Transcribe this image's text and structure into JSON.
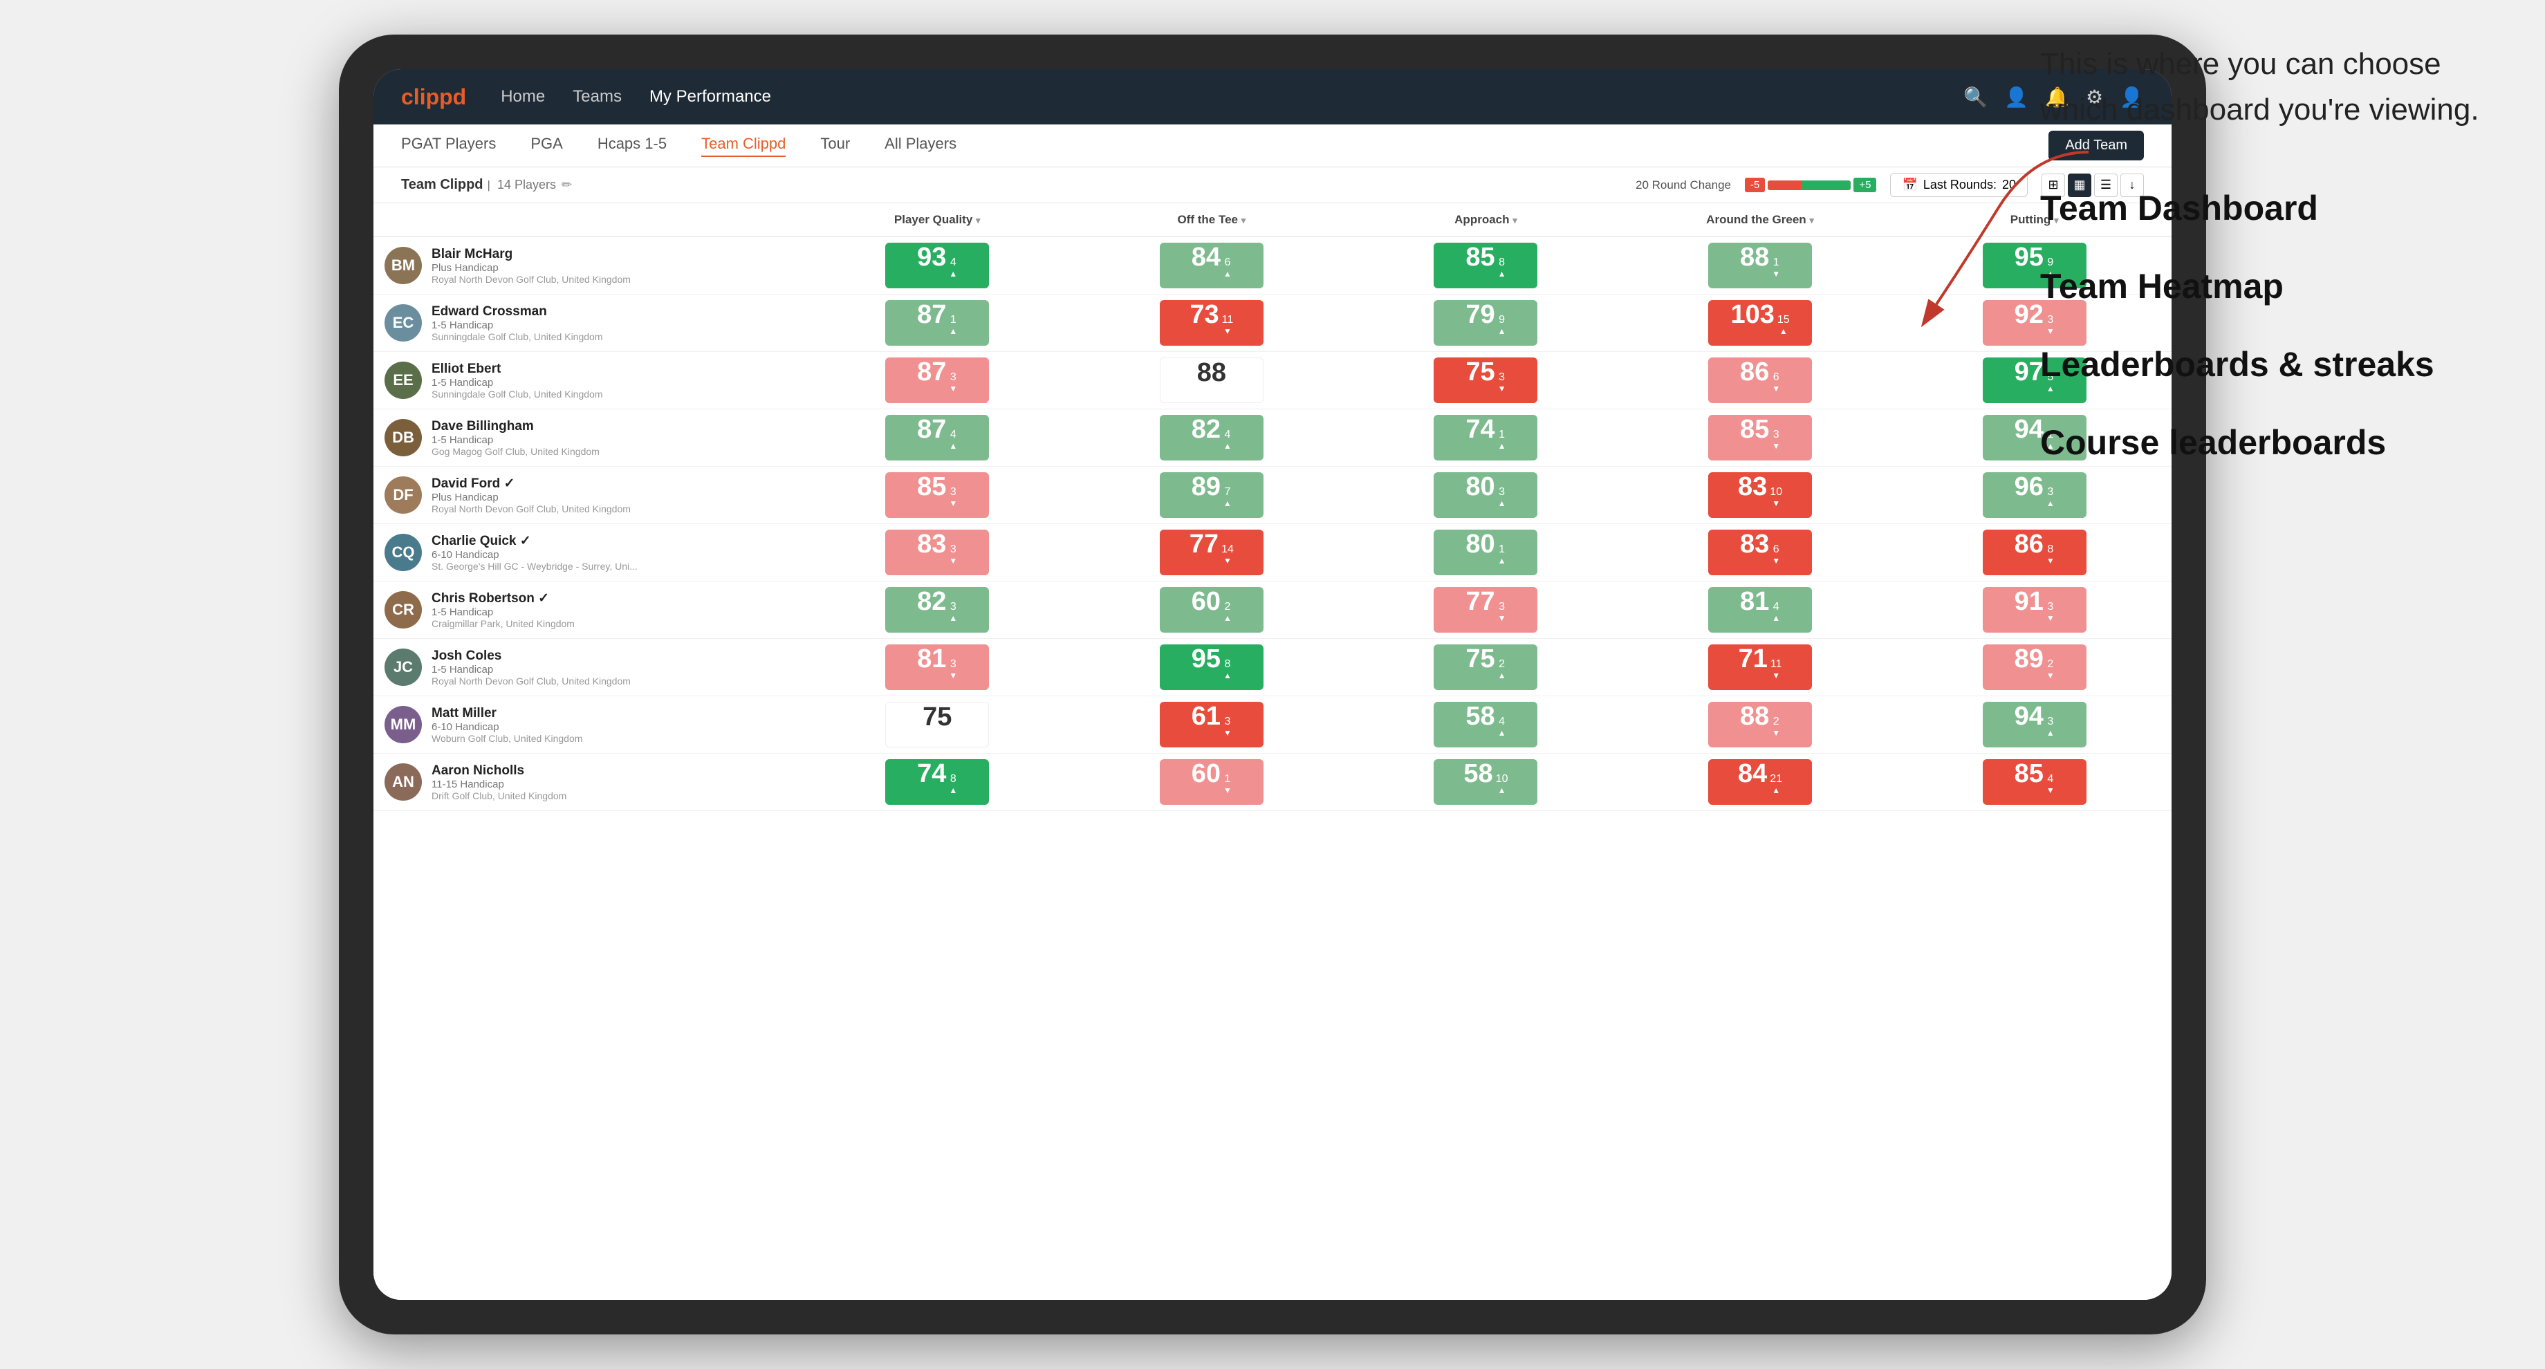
{
  "annotation": {
    "tooltip": "This is where you can choose which dashboard you're viewing.",
    "menu_items": [
      "Team Dashboard",
      "Team Heatmap",
      "Leaderboards & streaks",
      "Course leaderboards"
    ]
  },
  "nav": {
    "logo": "clippd",
    "links": [
      "Home",
      "Teams",
      "My Performance"
    ],
    "active_link": "My Performance"
  },
  "sub_nav": {
    "links": [
      "PGAT Players",
      "PGA",
      "Hcaps 1-5",
      "Team Clippd",
      "Tour",
      "All Players"
    ],
    "active_link": "Team Clippd",
    "add_team_label": "Add Team"
  },
  "team_bar": {
    "team_name": "Team Clippd",
    "player_count": "14 Players",
    "round_change_label": "20 Round Change",
    "change_neg": "-5",
    "change_pos": "+5",
    "last_rounds_label": "Last Rounds:",
    "last_rounds_value": "20"
  },
  "table": {
    "headers": [
      {
        "label": "Player Quality",
        "key": "player_quality",
        "sortable": true
      },
      {
        "label": "Off the Tee",
        "key": "off_tee",
        "sortable": true
      },
      {
        "label": "Approach",
        "key": "approach",
        "sortable": true
      },
      {
        "label": "Around the Green",
        "key": "around_green",
        "sortable": true
      },
      {
        "label": "Putting",
        "key": "putting",
        "sortable": true
      }
    ],
    "players": [
      {
        "name": "Blair McHarg",
        "hcp": "Plus Handicap",
        "club": "Royal North Devon Golf Club, United Kingdom",
        "avatar_color": "#8B7355",
        "initials": "BM",
        "scores": {
          "player_quality": {
            "value": 93,
            "delta": 4,
            "dir": "up",
            "color": "green-dark"
          },
          "off_tee": {
            "value": 84,
            "delta": 6,
            "dir": "up",
            "color": "green-light"
          },
          "approach": {
            "value": 85,
            "delta": 8,
            "dir": "up",
            "color": "green-dark"
          },
          "around_green": {
            "value": 88,
            "delta": 1,
            "dir": "down",
            "color": "green-light"
          },
          "putting": {
            "value": 95,
            "delta": 9,
            "dir": "up",
            "color": "green-dark"
          }
        }
      },
      {
        "name": "Edward Crossman",
        "hcp": "1-5 Handicap",
        "club": "Sunningdale Golf Club, United Kingdom",
        "avatar_color": "#6B8E9F",
        "initials": "EC",
        "scores": {
          "player_quality": {
            "value": 87,
            "delta": 1,
            "dir": "up",
            "color": "green-light"
          },
          "off_tee": {
            "value": 73,
            "delta": 11,
            "dir": "down",
            "color": "red-dark"
          },
          "approach": {
            "value": 79,
            "delta": 9,
            "dir": "up",
            "color": "green-light"
          },
          "around_green": {
            "value": 103,
            "delta": 15,
            "dir": "up",
            "color": "red-dark"
          },
          "putting": {
            "value": 92,
            "delta": 3,
            "dir": "down",
            "color": "red-light"
          }
        }
      },
      {
        "name": "Elliot Ebert",
        "hcp": "1-5 Handicap",
        "club": "Sunningdale Golf Club, United Kingdom",
        "avatar_color": "#5a6e4a",
        "initials": "EE",
        "scores": {
          "player_quality": {
            "value": 87,
            "delta": 3,
            "dir": "down",
            "color": "red-light"
          },
          "off_tee": {
            "value": 88,
            "delta": null,
            "dir": null,
            "color": "white"
          },
          "approach": {
            "value": 75,
            "delta": 3,
            "dir": "down",
            "color": "red-dark"
          },
          "around_green": {
            "value": 86,
            "delta": 6,
            "dir": "down",
            "color": "red-light"
          },
          "putting": {
            "value": 97,
            "delta": 5,
            "dir": "up",
            "color": "green-dark"
          }
        }
      },
      {
        "name": "Dave Billingham",
        "hcp": "1-5 Handicap",
        "club": "Gog Magog Golf Club, United Kingdom",
        "avatar_color": "#7B5E3A",
        "initials": "DB",
        "scores": {
          "player_quality": {
            "value": 87,
            "delta": 4,
            "dir": "up",
            "color": "green-light"
          },
          "off_tee": {
            "value": 82,
            "delta": 4,
            "dir": "up",
            "color": "green-light"
          },
          "approach": {
            "value": 74,
            "delta": 1,
            "dir": "up",
            "color": "green-light"
          },
          "around_green": {
            "value": 85,
            "delta": 3,
            "dir": "down",
            "color": "red-light"
          },
          "putting": {
            "value": 94,
            "delta": 1,
            "dir": "up",
            "color": "green-light"
          }
        }
      },
      {
        "name": "David Ford",
        "hcp": "Plus Handicap",
        "club": "Royal North Devon Golf Club, United Kingdom",
        "avatar_color": "#9E7B5A",
        "initials": "DF",
        "verified": true,
        "scores": {
          "player_quality": {
            "value": 85,
            "delta": 3,
            "dir": "down",
            "color": "red-light"
          },
          "off_tee": {
            "value": 89,
            "delta": 7,
            "dir": "up",
            "color": "green-light"
          },
          "approach": {
            "value": 80,
            "delta": 3,
            "dir": "up",
            "color": "green-light"
          },
          "around_green": {
            "value": 83,
            "delta": 10,
            "dir": "down",
            "color": "red-dark"
          },
          "putting": {
            "value": 96,
            "delta": 3,
            "dir": "up",
            "color": "green-light"
          }
        }
      },
      {
        "name": "Charlie Quick",
        "hcp": "6-10 Handicap",
        "club": "St. George's Hill GC - Weybridge - Surrey, Uni...",
        "avatar_color": "#4A7B8C",
        "initials": "CQ",
        "verified": true,
        "scores": {
          "player_quality": {
            "value": 83,
            "delta": 3,
            "dir": "down",
            "color": "red-light"
          },
          "off_tee": {
            "value": 77,
            "delta": 14,
            "dir": "down",
            "color": "red-dark"
          },
          "approach": {
            "value": 80,
            "delta": 1,
            "dir": "up",
            "color": "green-light"
          },
          "around_green": {
            "value": 83,
            "delta": 6,
            "dir": "down",
            "color": "red-dark"
          },
          "putting": {
            "value": 86,
            "delta": 8,
            "dir": "down",
            "color": "red-dark"
          }
        }
      },
      {
        "name": "Chris Robertson",
        "hcp": "1-5 Handicap",
        "club": "Craigmillar Park, United Kingdom",
        "avatar_color": "#8E6B4A",
        "initials": "CR",
        "verified": true,
        "scores": {
          "player_quality": {
            "value": 82,
            "delta": 3,
            "dir": "up",
            "color": "green-light"
          },
          "off_tee": {
            "value": 60,
            "delta": 2,
            "dir": "up",
            "color": "green-light"
          },
          "approach": {
            "value": 77,
            "delta": 3,
            "dir": "down",
            "color": "red-light"
          },
          "around_green": {
            "value": 81,
            "delta": 4,
            "dir": "up",
            "color": "green-light"
          },
          "putting": {
            "value": 91,
            "delta": 3,
            "dir": "down",
            "color": "red-light"
          }
        }
      },
      {
        "name": "Josh Coles",
        "hcp": "1-5 Handicap",
        "club": "Royal North Devon Golf Club, United Kingdom",
        "avatar_color": "#5A7B6E",
        "initials": "JC",
        "scores": {
          "player_quality": {
            "value": 81,
            "delta": 3,
            "dir": "down",
            "color": "red-light"
          },
          "off_tee": {
            "value": 95,
            "delta": 8,
            "dir": "up",
            "color": "green-dark"
          },
          "approach": {
            "value": 75,
            "delta": 2,
            "dir": "up",
            "color": "green-light"
          },
          "around_green": {
            "value": 71,
            "delta": 11,
            "dir": "down",
            "color": "red-dark"
          },
          "putting": {
            "value": 89,
            "delta": 2,
            "dir": "down",
            "color": "red-light"
          }
        }
      },
      {
        "name": "Matt Miller",
        "hcp": "6-10 Handicap",
        "club": "Woburn Golf Club, United Kingdom",
        "avatar_color": "#7A5E8B",
        "initials": "MM",
        "scores": {
          "player_quality": {
            "value": 75,
            "delta": null,
            "dir": null,
            "color": "white"
          },
          "off_tee": {
            "value": 61,
            "delta": 3,
            "dir": "down",
            "color": "red-dark"
          },
          "approach": {
            "value": 58,
            "delta": 4,
            "dir": "up",
            "color": "green-light"
          },
          "around_green": {
            "value": 88,
            "delta": 2,
            "dir": "down",
            "color": "red-light"
          },
          "putting": {
            "value": 94,
            "delta": 3,
            "dir": "up",
            "color": "green-light"
          }
        }
      },
      {
        "name": "Aaron Nicholls",
        "hcp": "11-15 Handicap",
        "club": "Drift Golf Club, United Kingdom",
        "avatar_color": "#8B6A5A",
        "initials": "AN",
        "scores": {
          "player_quality": {
            "value": 74,
            "delta": 8,
            "dir": "up",
            "color": "green-dark"
          },
          "off_tee": {
            "value": 60,
            "delta": 1,
            "dir": "down",
            "color": "red-light"
          },
          "approach": {
            "value": 58,
            "delta": 10,
            "dir": "up",
            "color": "green-light"
          },
          "around_green": {
            "value": 84,
            "delta": 21,
            "dir": "up",
            "color": "red-dark"
          },
          "putting": {
            "value": 85,
            "delta": 4,
            "dir": "down",
            "color": "red-dark"
          }
        }
      }
    ]
  }
}
